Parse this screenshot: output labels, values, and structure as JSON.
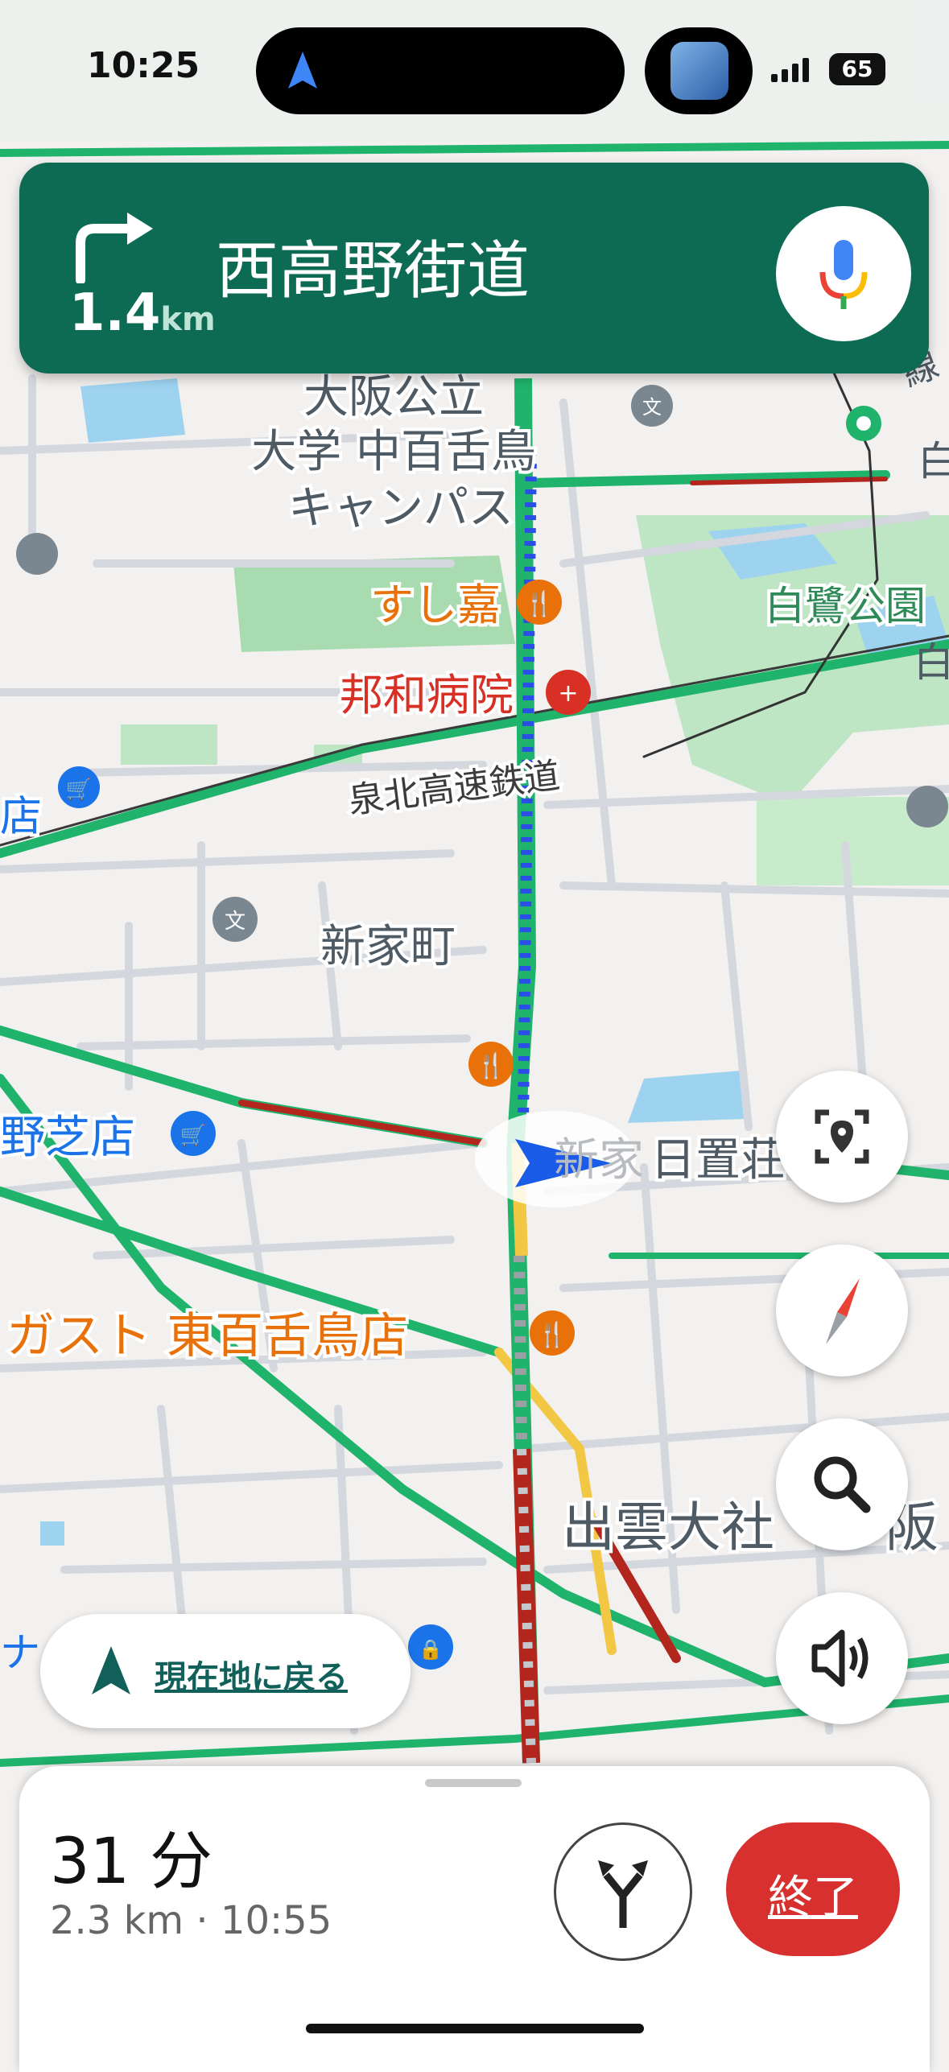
{
  "status_bar": {
    "time": "10:25",
    "battery": "65"
  },
  "navigation": {
    "distance_value": "1.4",
    "distance_unit": "km",
    "street_name": "西高野街道"
  },
  "map_labels": {
    "university": [
      "大阪公立",
      "大学 中百舌鳥",
      "キャンパス"
    ],
    "sushi": "すし嘉",
    "hospital": "邦和病院",
    "railway": "泉北高速鉄道",
    "town": "新家町",
    "park": "白鷺公園",
    "left_store": "野芝店",
    "left_store2": "店",
    "gusto": "ガスト 東百舌鳥店",
    "hioki": "日置荘",
    "shinke": "新家",
    "izumo": "出雲大社",
    "izumo_tail": "阪",
    "right_edge_1": "白",
    "right_edge_2": "白",
    "right_edge_3": "線",
    "left_edge": "ナ"
  },
  "controls": {
    "recenter_label": "現在地に戻る"
  },
  "trip": {
    "duration": "31 分",
    "details": "2.3 km · 10:55",
    "end_label": "終了"
  },
  "colors": {
    "nav_green": "#0e6b53",
    "route_blue": "#2b4ee8",
    "traffic_green": "#1fb36b",
    "traffic_red": "#b3261e",
    "end_red": "#d8302f",
    "poi_orange": "#e8710a",
    "hospital_red": "#d93025",
    "shop_blue": "#1a73e8"
  }
}
